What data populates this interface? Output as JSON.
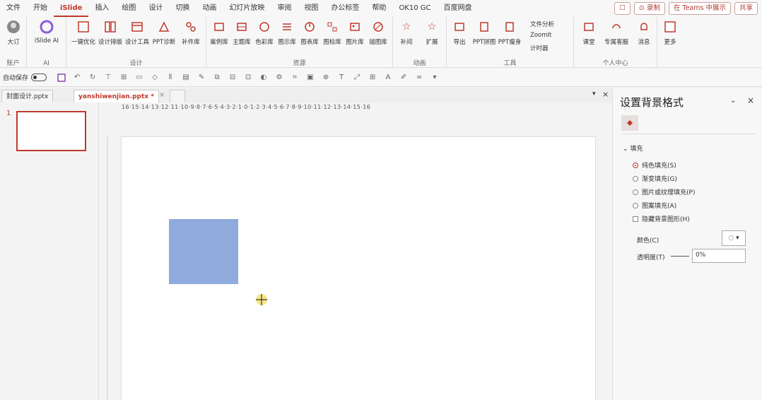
{
  "menubar": {
    "items": [
      "文件",
      "开始",
      "iSlide",
      "插入",
      "绘图",
      "设计",
      "切换",
      "动画",
      "幻灯片放映",
      "审阅",
      "视图",
      "办公标签",
      "帮助",
      "OK10 GC",
      "百度网盘"
    ],
    "active": "iSlide",
    "right": {
      "comment": "☐",
      "record": "⊙ 录制",
      "teams": "在 Teams 中展示",
      "share": "共享"
    }
  },
  "ribbon": {
    "groups": [
      {
        "label": "账户",
        "buttons": [
          "大订"
        ]
      },
      {
        "label": "AI",
        "buttons": [
          "iSlide AI"
        ]
      },
      {
        "label": "设计",
        "buttons": [
          "一键优化",
          "设计排版",
          "设计工具",
          "PPT诊断",
          "补件库"
        ]
      },
      {
        "label": "资源",
        "buttons": [
          "案例库",
          "主题库",
          "色彩库",
          "图示库",
          "图表库",
          "图标库",
          "图片库",
          "插图库"
        ]
      },
      {
        "label": "动画",
        "buttons": [
          "补间",
          "扩展"
        ]
      },
      {
        "label": "工具",
        "buttons": [
          "导出",
          "PPT拼图",
          "PPT瘦身"
        ],
        "small": [
          "文件分析",
          "ZoomIt",
          "计时器"
        ]
      },
      {
        "label": "个人中心",
        "buttons": [
          "课堂",
          "专属客服",
          "消息"
        ]
      },
      {
        "label": "",
        "buttons": [
          "更多"
        ]
      }
    ]
  },
  "qat": {
    "autosave_label": "自动保存"
  },
  "tabs": [
    {
      "label": "封面设计.pptx",
      "active": false
    },
    {
      "label": "yanshiwenjian.pptx *",
      "active": true
    }
  ],
  "ruler": {
    "labels": "16·15·14·13·12·11·10·9·8·7·6·5·4·3·2·1·0·1·2·3·4·5·6·7·8·9·10·11·12·13·14·15·16"
  },
  "thumbnail": {
    "number": "1"
  },
  "shape": {
    "fill": "#8faadc"
  },
  "panel": {
    "title": "设置背景格式",
    "section": "填充",
    "options": [
      "纯色填充(S)",
      "渐变填充(G)",
      "图片或纹理填充(P)",
      "图案填充(A)"
    ],
    "hide_bg": "隐藏背景图形(H)",
    "color_label": "颜色(C)",
    "transparency_label": "透明度(T)",
    "transparency_value": "0%"
  },
  "colors": {
    "accent": "#c0392b",
    "shape": "#8faadc"
  }
}
